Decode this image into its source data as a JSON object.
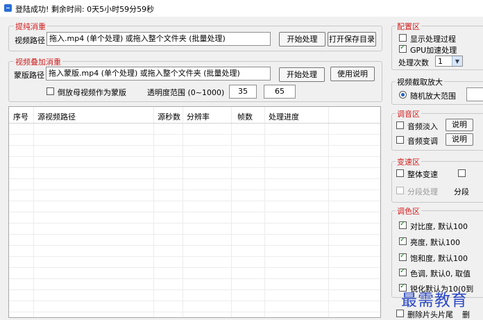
{
  "titlebar": {
    "status": "登陆成功! 剩余时间: 0天5小时59分59秒"
  },
  "extract": {
    "legend": "提纯消重",
    "path_label": "视频路径",
    "path_value": "拖入.mp4 (单个处理) 或拖入整个文件夹 (批量处理)",
    "start_button": "开始处理",
    "open_dir_button": "打开保存目录"
  },
  "overlay": {
    "legend": "视频叠加消重",
    "mask_label": "蒙版路径",
    "mask_value": "拖入蒙版.mp4 (单个处理) 或拖入整个文件夹 (批量处理)",
    "start_button": "开始处理",
    "help_button": "使用说明",
    "invert_label": "倒放母视频作为蒙版",
    "opacity_label": "透明度范围 (0~1000)",
    "opacity_min": "35",
    "opacity_max": "65"
  },
  "table": {
    "columns": [
      "序号",
      "源视频路径",
      "源秒数",
      "分辨率",
      "帧数",
      "处理进度"
    ],
    "rows": []
  },
  "config": {
    "legend": "配置区",
    "show_process": "显示处理过程",
    "gpu": "GPU加速处理",
    "count_label": "处理次数",
    "count_value": "1"
  },
  "crop": {
    "legend": "视频截取放大",
    "random_label": "随机放大范围"
  },
  "audio": {
    "legend": "调音区",
    "fade_in": "音频淡入",
    "pitch": "音频变调",
    "help1": "说明",
    "help2": "说明"
  },
  "speed": {
    "legend": "变速区",
    "overall": "整体变速",
    "segment": "分段处理",
    "segment2": "分段"
  },
  "color": {
    "legend": "调色区",
    "items": [
      "对比度, 默认100",
      "亮度, 默认100",
      "饱和度, 默认100",
      "色调, 默认0, 取值",
      "锐化默认为10(0到"
    ]
  },
  "trim": {
    "label": "删除片头片尾",
    "label2": "删"
  },
  "watermark": {
    "text": "最需教育"
  }
}
